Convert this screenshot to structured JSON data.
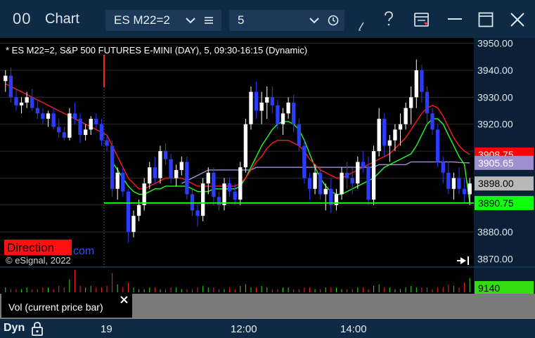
{
  "window": {
    "title": "Chart",
    "title_icon": "00",
    "symbol": "ES M22=2",
    "interval": "5",
    "icons": [
      "chevron-down-icon",
      "menu-icon",
      "chevron-down-icon",
      "clock-icon",
      "pencil-icon",
      "help-icon",
      "window-menu-icon",
      "minimize-icon",
      "maximize-icon",
      "close-icon"
    ]
  },
  "chart": {
    "header": "* ES M22=2, S&P 500 FUTURES E-MINI (DAY), 5, 09:30-16:15 (Dynamic)",
    "watermark": "© eSignal, 2022",
    "direction_label": "Direction",
    "direction_suffix": "com",
    "price_ticks": [
      "3950.00",
      "3940.00",
      "3930.00",
      "3920.00",
      "3880.00",
      "3870.00"
    ],
    "price_labels": [
      {
        "text": "3908.75",
        "bg": "#ff0000",
        "fg": "#ffffff"
      },
      {
        "text": "3905.65",
        "bg": "#9f8fd0",
        "fg": "#ffffff"
      },
      {
        "text": "3898.00",
        "bg": "#b8b8b8",
        "fg": "#000000"
      },
      {
        "text": "3890.75",
        "bg": "#10ff10",
        "fg": "#000000"
      }
    ],
    "volume_label": "9140",
    "volume_bg": "#33dd10",
    "vol_panel_title": "Vol (current price bar)",
    "time_labels": [
      "19",
      "12:00",
      "14:00"
    ],
    "scroll_right_icon": "scroll-right-icon",
    "colors": {
      "up": "#ffffff",
      "down": "#2a3cff",
      "ma_red": "#ff1a1a",
      "ma_green": "#22ff22",
      "ma_purple": "#a48fd6",
      "level_green": "#10ff10"
    }
  },
  "bottom": {
    "mode": "Dyn",
    "lock_icon": "lock-icon"
  },
  "chart_data": {
    "type": "candlestick",
    "title": "* ES M22=2, S&P 500 FUTURES E-MINI (DAY), 5, 09:30-16:15 (Dynamic)",
    "xlabel": "",
    "ylabel": "",
    "ylim": [
      3867,
      3952
    ],
    "y_ticks": [
      3950,
      3940,
      3930,
      3920,
      3880,
      3870
    ],
    "x_ticks": [
      "19",
      "12:00",
      "14:00"
    ],
    "horizontal_levels": [
      3890.75
    ],
    "last_values": {
      "price": 3898.0,
      "ma_red": 3908.75,
      "ma_purple": 3905.65,
      "ma_green": 3890.75,
      "volume": 9140
    },
    "candles": [
      [
        3936,
        3940,
        3932,
        3938
      ],
      [
        3938,
        3941,
        3928,
        3930
      ],
      [
        3930,
        3933,
        3925,
        3927
      ],
      [
        3927,
        3930,
        3924,
        3928
      ],
      [
        3928,
        3932,
        3926,
        3930
      ],
      [
        3930,
        3933,
        3925,
        3926
      ],
      [
        3926,
        3929,
        3922,
        3924
      ],
      [
        3924,
        3926,
        3920,
        3922
      ],
      [
        3922,
        3925,
        3919,
        3924
      ],
      [
        3924,
        3926,
        3918,
        3919
      ],
      [
        3919,
        3922,
        3915,
        3917
      ],
      [
        3917,
        3919,
        3914,
        3915
      ],
      [
        3915,
        3926,
        3914,
        3924
      ],
      [
        3924,
        3928,
        3920,
        3922
      ],
      [
        3922,
        3924,
        3913,
        3916
      ],
      [
        3916,
        3920,
        3914,
        3918
      ],
      [
        3918,
        3923,
        3916,
        3922
      ],
      [
        3922,
        3924,
        3918,
        3920
      ],
      [
        3920,
        3922,
        3912,
        3914
      ],
      [
        3914,
        3916,
        3910,
        3912
      ],
      [
        3912,
        3914,
        3893,
        3896
      ],
      [
        3896,
        3904,
        3892,
        3902
      ],
      [
        3902,
        3904,
        3893,
        3895
      ],
      [
        3895,
        3896,
        3876,
        3880
      ],
      [
        3880,
        3888,
        3878,
        3886
      ],
      [
        3886,
        3892,
        3884,
        3890
      ],
      [
        3890,
        3900,
        3888,
        3898
      ],
      [
        3898,
        3906,
        3896,
        3904
      ],
      [
        3904,
        3908,
        3898,
        3900
      ],
      [
        3900,
        3912,
        3898,
        3910
      ],
      [
        3910,
        3913,
        3905,
        3907
      ],
      [
        3907,
        3909,
        3898,
        3900
      ],
      [
        3900,
        3905,
        3897,
        3903
      ],
      [
        3903,
        3908,
        3901,
        3906
      ],
      [
        3906,
        3908,
        3892,
        3894
      ],
      [
        3894,
        3896,
        3886,
        3888
      ],
      [
        3888,
        3890,
        3882,
        3886
      ],
      [
        3886,
        3900,
        3884,
        3898
      ],
      [
        3898,
        3904,
        3894,
        3902
      ],
      [
        3902,
        3904,
        3890,
        3893
      ],
      [
        3893,
        3895,
        3888,
        3890
      ],
      [
        3890,
        3900,
        3888,
        3898
      ],
      [
        3898,
        3900,
        3893,
        3895
      ],
      [
        3895,
        3898,
        3890,
        3892
      ],
      [
        3892,
        3906,
        3890,
        3904
      ],
      [
        3904,
        3922,
        3902,
        3920
      ],
      [
        3920,
        3934,
        3918,
        3932
      ],
      [
        3932,
        3936,
        3922,
        3925
      ],
      [
        3925,
        3932,
        3920,
        3928
      ],
      [
        3928,
        3934,
        3922,
        3930
      ],
      [
        3930,
        3934,
        3924,
        3927
      ],
      [
        3927,
        3929,
        3918,
        3920
      ],
      [
        3920,
        3926,
        3916,
        3924
      ],
      [
        3924,
        3930,
        3922,
        3928
      ],
      [
        3928,
        3931,
        3917,
        3920
      ],
      [
        3920,
        3922,
        3910,
        3912
      ],
      [
        3912,
        3914,
        3898,
        3900
      ],
      [
        3900,
        3902,
        3892,
        3896
      ],
      [
        3896,
        3905,
        3894,
        3902
      ],
      [
        3902,
        3904,
        3892,
        3894
      ],
      [
        3894,
        3898,
        3888,
        3896
      ],
      [
        3896,
        3900,
        3887,
        3890
      ],
      [
        3890,
        3896,
        3888,
        3894
      ],
      [
        3894,
        3904,
        3892,
        3902
      ],
      [
        3902,
        3906,
        3896,
        3900
      ],
      [
        3900,
        3904,
        3894,
        3898
      ],
      [
        3898,
        3908,
        3896,
        3906
      ],
      [
        3906,
        3910,
        3902,
        3904
      ],
      [
        3904,
        3908,
        3890,
        3892
      ],
      [
        3892,
        3912,
        3890,
        3910
      ],
      [
        3910,
        3926,
        3908,
        3922
      ],
      [
        3922,
        3924,
        3908,
        3912
      ],
      [
        3912,
        3916,
        3906,
        3914
      ],
      [
        3914,
        3920,
        3910,
        3918
      ],
      [
        3918,
        3924,
        3912,
        3920
      ],
      [
        3920,
        3928,
        3918,
        3926
      ],
      [
        3926,
        3934,
        3920,
        3930
      ],
      [
        3930,
        3944,
        3926,
        3940
      ],
      [
        3940,
        3942,
        3928,
        3932
      ],
      [
        3932,
        3934,
        3920,
        3924
      ],
      [
        3924,
        3926,
        3916,
        3918
      ],
      [
        3918,
        3920,
        3904,
        3906
      ],
      [
        3906,
        3908,
        3898,
        3902
      ],
      [
        3902,
        3906,
        3894,
        3896
      ],
      [
        3896,
        3902,
        3892,
        3900
      ],
      [
        3900,
        3904,
        3894,
        3896
      ],
      [
        3896,
        3900,
        3891,
        3894
      ],
      [
        3894,
        3900,
        3890,
        3898
      ]
    ],
    "ma_red": [
      3935,
      3934,
      3933,
      3932,
      3931,
      3930,
      3929,
      3928,
      3927,
      3926,
      3925,
      3924,
      3923,
      3922,
      3921,
      3920,
      3919,
      3918,
      3917,
      3916,
      3912,
      3908,
      3904,
      3900,
      3898,
      3896,
      3896,
      3897,
      3898,
      3899,
      3900,
      3900,
      3900,
      3900,
      3899,
      3898,
      3897,
      3897,
      3897,
      3897,
      3897,
      3897,
      3897,
      3897,
      3898,
      3900,
      3903,
      3906,
      3908,
      3911,
      3913,
      3914,
      3914,
      3914,
      3913,
      3912,
      3910,
      3907,
      3905,
      3903,
      3902,
      3901,
      3900,
      3900,
      3901,
      3902,
      3903,
      3904,
      3905,
      3906,
      3907,
      3908,
      3909,
      3911,
      3913,
      3915,
      3918,
      3921,
      3924,
      3926,
      3927,
      3926,
      3923,
      3919,
      3915,
      3912,
      3910,
      3908.75
    ],
    "ma_green": [
      null,
      null,
      null,
      null,
      null,
      null,
      null,
      null,
      null,
      null,
      null,
      null,
      null,
      null,
      null,
      null,
      null,
      null,
      null,
      null,
      3906,
      3903,
      3900,
      3897,
      3895,
      3894,
      3894,
      3895,
      3896,
      3896,
      3897,
      3897,
      3897,
      3897,
      3897,
      3896,
      3895,
      3895,
      3895,
      3896,
      3896,
      3896,
      3896,
      3896,
      3897,
      3900,
      3904,
      3908,
      3912,
      3915,
      3918,
      3920,
      3921,
      3921,
      3920,
      3918,
      3914,
      3909,
      3904,
      3900,
      3897,
      3895,
      3894,
      3894,
      3895,
      3896,
      3897,
      3898,
      3899,
      3900,
      3902,
      3904,
      3905,
      3906,
      3907,
      3908,
      3909,
      3912,
      3916,
      3920,
      3922,
      3922,
      3920,
      3916,
      3912,
      3908,
      3905,
      3890.75
    ],
    "ma_purple": [
      null,
      null,
      null,
      null,
      null,
      null,
      null,
      null,
      null,
      null,
      null,
      null,
      null,
      null,
      null,
      null,
      null,
      null,
      null,
      null,
      null,
      null,
      null,
      null,
      null,
      null,
      null,
      null,
      null,
      null,
      null,
      null,
      null,
      3898,
      3899,
      3900,
      3901,
      3902,
      3903,
      3903,
      3903,
      3903,
      3903,
      3903,
      3903,
      3903,
      3903,
      3904,
      3904,
      3904,
      3904,
      3904,
      3904,
      3904,
      3904,
      3904,
      3904,
      3904,
      3904,
      3904,
      3904,
      3904,
      3904,
      3904,
      3904,
      3904,
      3904,
      3904,
      3904,
      3904,
      3905,
      3905,
      3905,
      3905,
      3905,
      3905,
      3906,
      3906,
      3906,
      3906,
      3906,
      3906,
      3906,
      3906,
      3906,
      3905.8,
      3905.7,
      3905.65
    ],
    "volume": [
      3,
      2,
      2,
      2,
      3,
      2,
      2,
      3,
      3,
      2,
      4,
      3,
      8,
      14,
      4,
      3,
      4,
      3,
      3,
      4,
      12,
      5,
      3,
      6,
      3,
      2,
      2,
      3,
      3,
      2,
      2,
      3,
      3,
      2,
      2,
      2,
      3,
      4,
      3,
      3,
      2,
      2,
      3,
      2,
      4,
      5,
      3,
      3,
      4,
      3,
      2,
      2,
      3,
      3,
      2,
      2,
      3,
      3,
      2,
      2,
      3,
      3,
      3,
      2,
      2,
      2,
      3,
      3,
      2,
      4,
      5,
      3,
      3,
      2,
      2,
      3,
      4,
      3,
      3,
      3,
      2,
      3,
      3,
      5,
      4,
      3,
      6,
      9
    ]
  }
}
